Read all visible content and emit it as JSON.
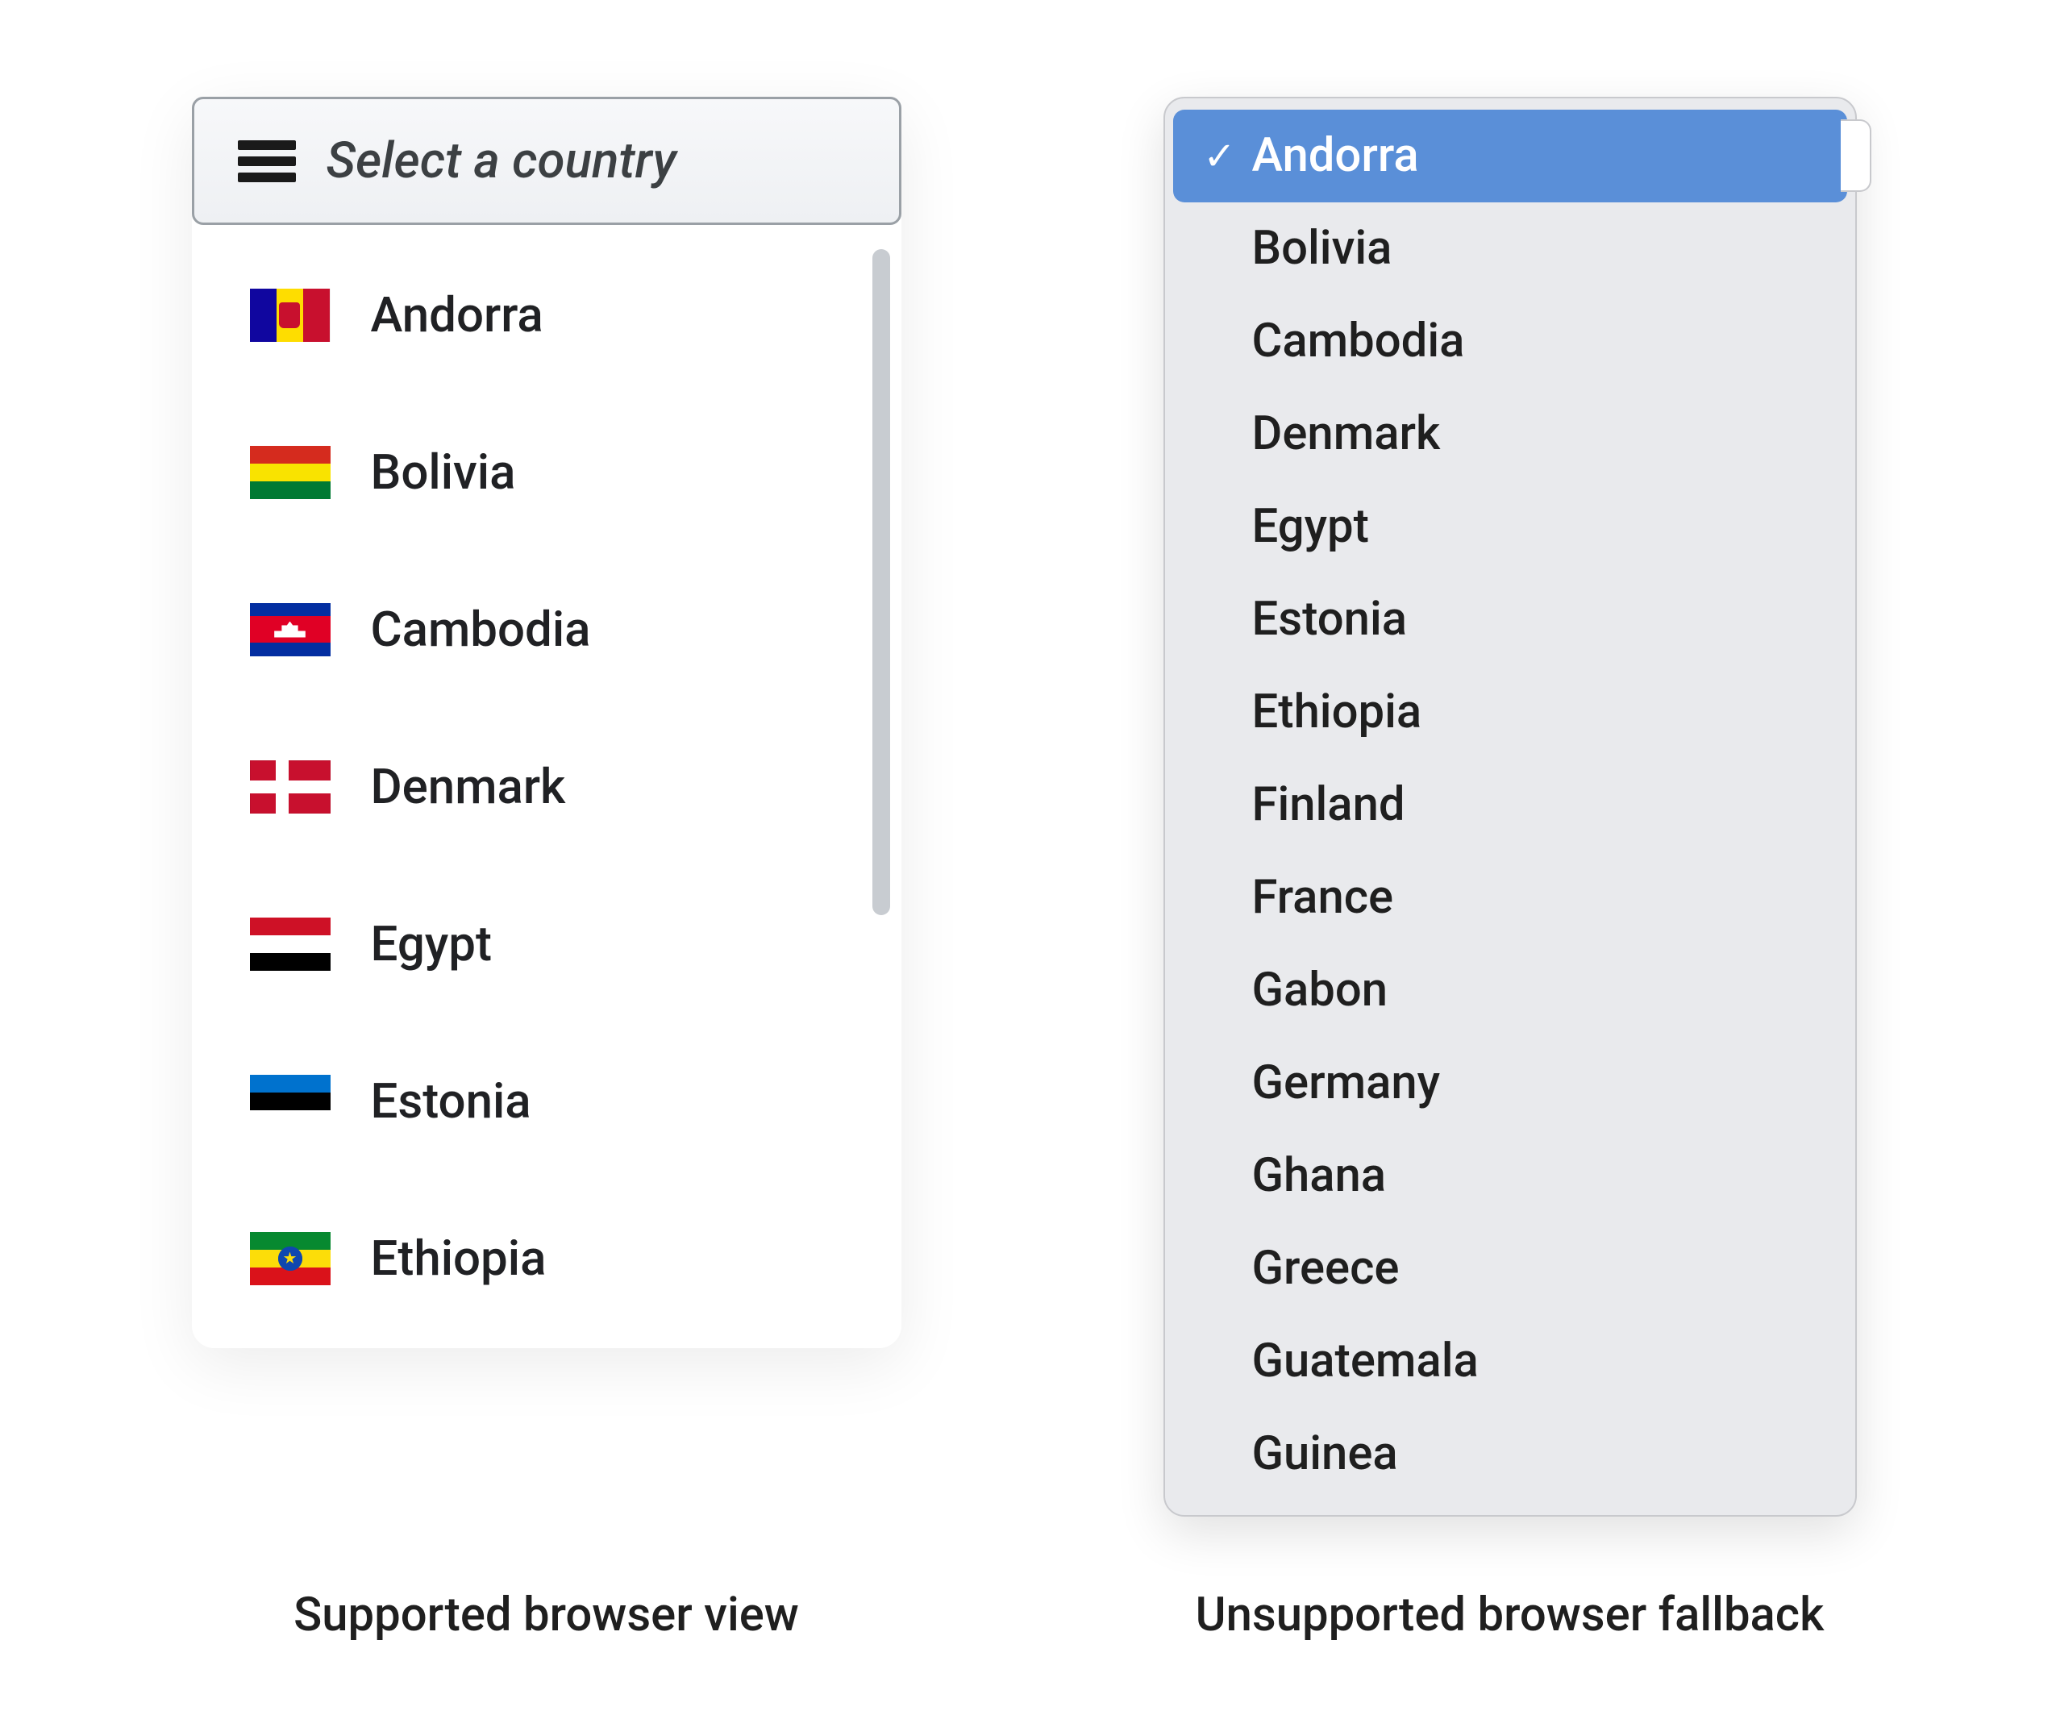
{
  "select": {
    "placeholder": "Select a country",
    "options": [
      {
        "code": "ad",
        "label": "Andorra"
      },
      {
        "code": "bo",
        "label": "Bolivia"
      },
      {
        "code": "kh",
        "label": "Cambodia"
      },
      {
        "code": "dk",
        "label": "Denmark"
      },
      {
        "code": "eg",
        "label": "Egypt"
      },
      {
        "code": "ee",
        "label": "Estonia"
      },
      {
        "code": "et",
        "label": "Ethiopia"
      }
    ]
  },
  "native": {
    "selected_index": 0,
    "options": [
      "Andorra",
      "Bolivia",
      "Cambodia",
      "Denmark",
      "Egypt",
      "Estonia",
      "Ethiopia",
      "Finland",
      "France",
      "Gabon",
      "Germany",
      "Ghana",
      "Greece",
      "Guatemala",
      "Guinea"
    ]
  },
  "captions": {
    "left": "Supported browser view",
    "right": "Unsupported browser fallback"
  },
  "colors": {
    "native_highlight": "#5a8fd8",
    "button_border": "#9aa0a6",
    "scrollbar_thumb": "#c8ccd1"
  }
}
